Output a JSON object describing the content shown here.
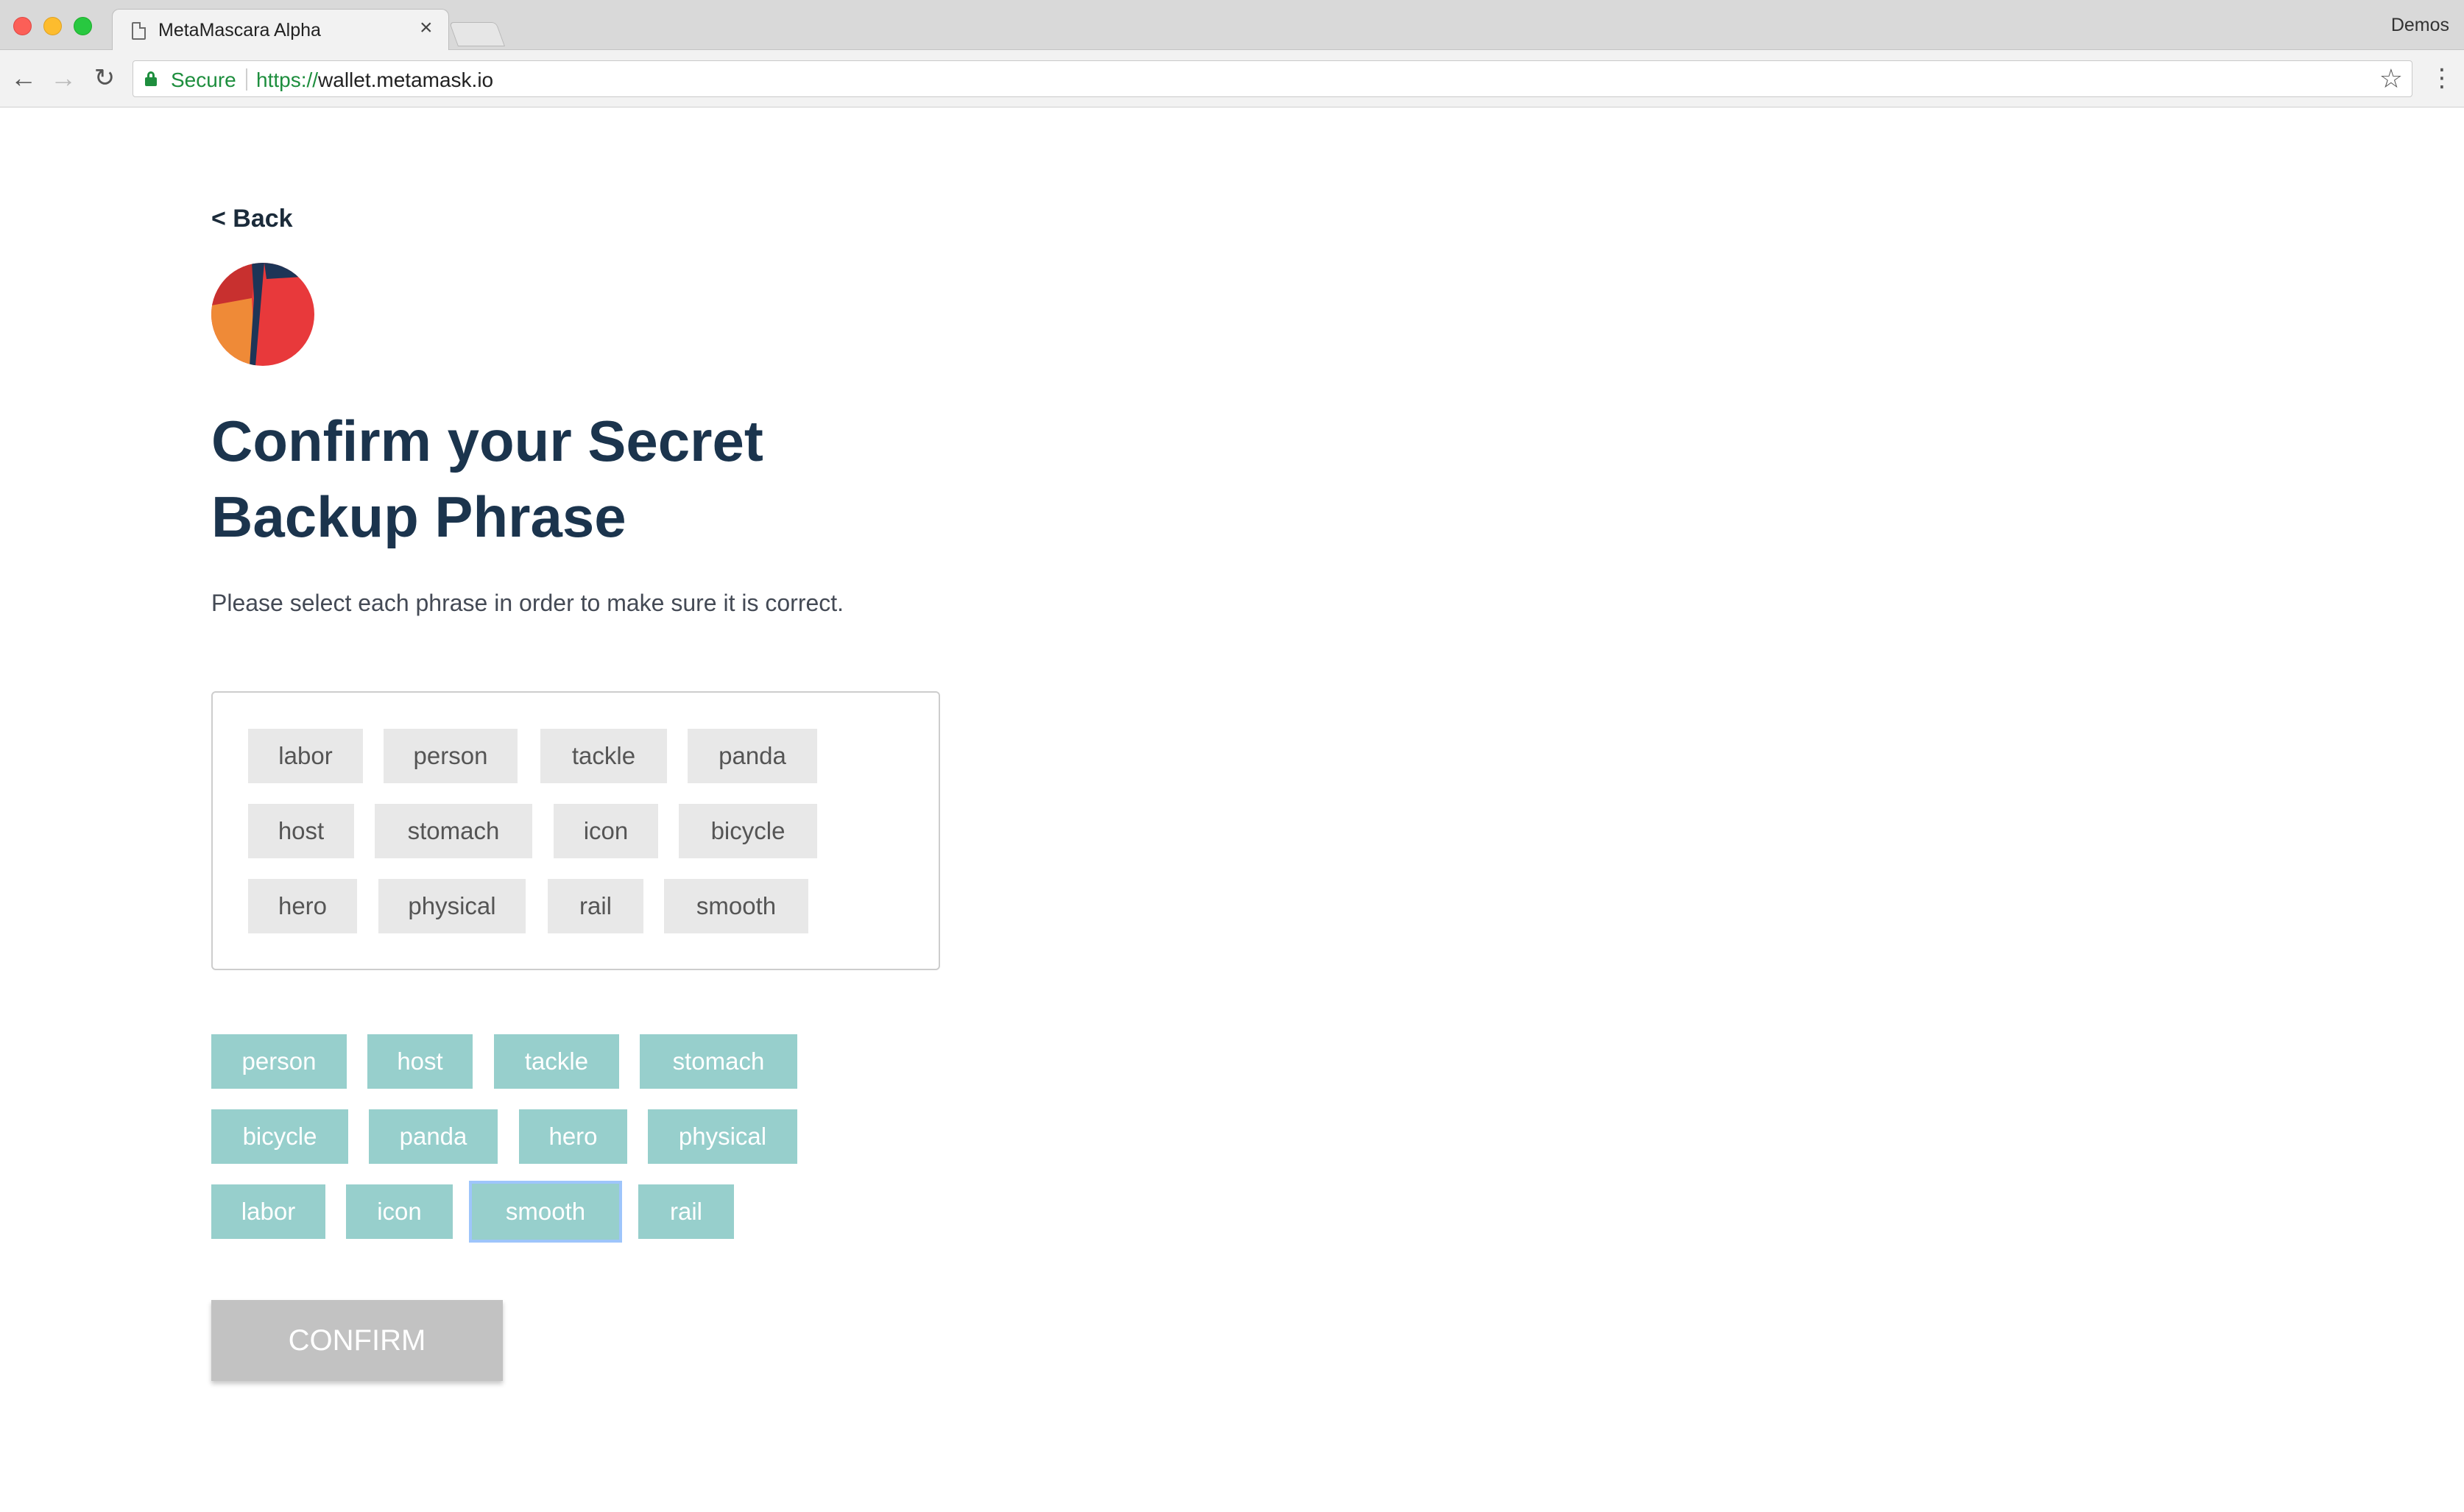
{
  "browser": {
    "tab_title": "MetaMascara Alpha",
    "tab_close": "×",
    "profile_name": "Demos",
    "secure_label": "Secure",
    "url_scheme": "https://",
    "url_host": "wallet.metamask.io",
    "icons": {
      "back": "back-arrow-icon",
      "forward": "forward-arrow-icon",
      "reload": "reload-icon",
      "lock": "lock-icon",
      "star": "star-icon",
      "menu": "kebab-menu-icon"
    }
  },
  "page": {
    "back_label": "< Back",
    "title": "Confirm your Secret Backup Phrase",
    "instructions": "Please select each phrase in order to make sure it is correct.",
    "confirm_label": "CONFIRM",
    "confirm_enabled": false
  },
  "selected_words": [
    "labor",
    "person",
    "tackle",
    "panda",
    "host",
    "stomach",
    "icon",
    "bicycle",
    "hero",
    "physical",
    "rail",
    "smooth"
  ],
  "available_words": [
    "person",
    "host",
    "tackle",
    "stomach",
    "bicycle",
    "panda",
    "hero",
    "physical",
    "labor",
    "icon",
    "smooth",
    "rail"
  ],
  "focused_available_word": "smooth",
  "colors": {
    "title": "#1b344d",
    "available_word_bg": "#97cfcc",
    "selected_word_bg": "#e8e8e8",
    "confirm_disabled_bg": "#c2c2c2",
    "secure_green": "#1e8e3e",
    "focus_ring": "#9ec5fb"
  }
}
